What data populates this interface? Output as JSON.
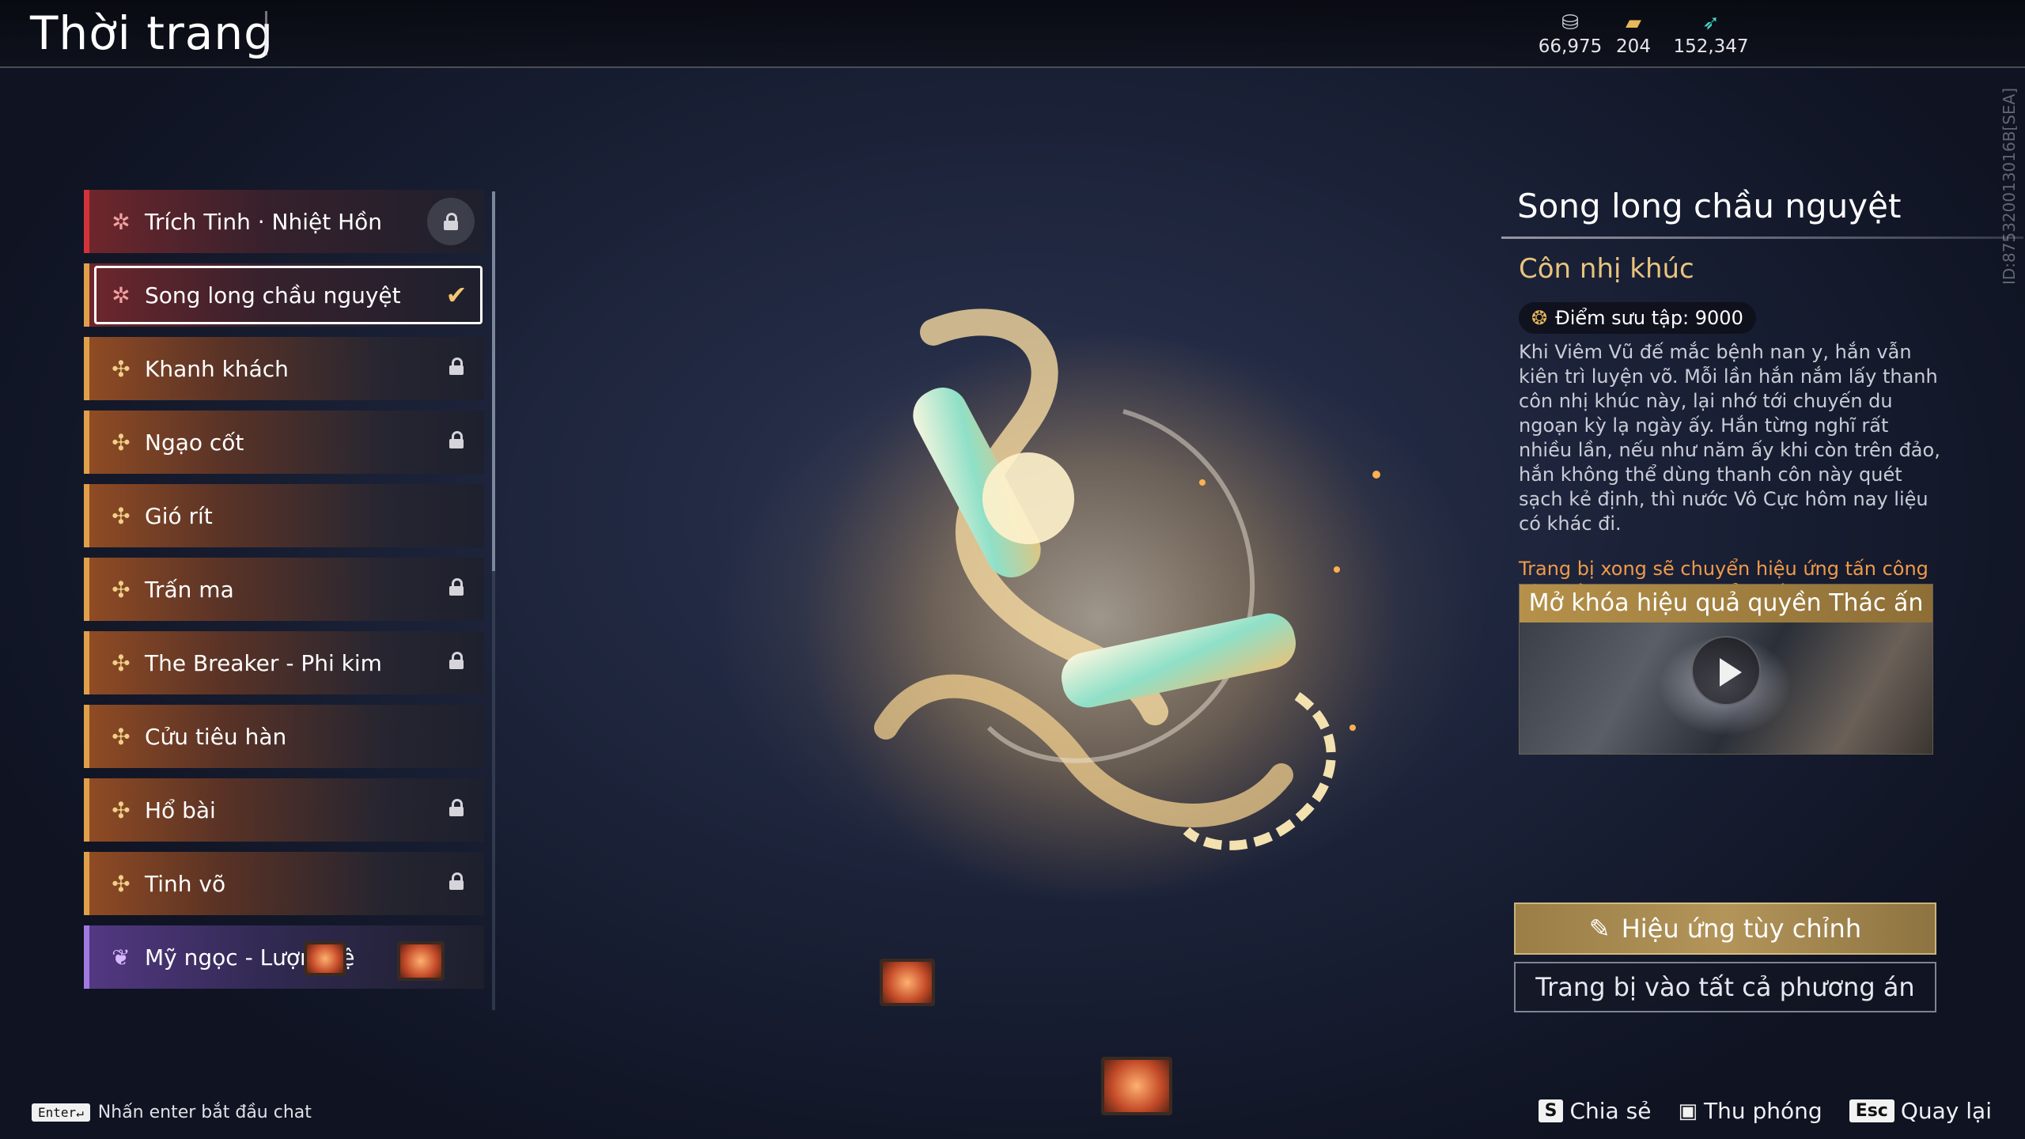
{
  "header": {
    "title": "Thời trang",
    "currencies": [
      {
        "icon": "coin-stack-icon",
        "value": "66,975"
      },
      {
        "icon": "treasure-chest-icon",
        "value": "204"
      },
      {
        "icon": "feather-icon",
        "value": "152,347"
      }
    ],
    "side_id": "ID:875320013016B[SEA]"
  },
  "list": {
    "items": [
      {
        "label": "Trích Tinh · Nhiệt Hồn",
        "status": "locked",
        "style": "red"
      },
      {
        "label": "Song long chầu nguyệt",
        "status": "equipped",
        "style": "selected"
      },
      {
        "label": "Khanh khách",
        "status": "locked",
        "style": "gold"
      },
      {
        "label": "Ngạo cốt",
        "status": "locked",
        "style": "gold"
      },
      {
        "label": "Gió rít",
        "status": "none",
        "style": "gold"
      },
      {
        "label": "Trấn ma",
        "status": "locked",
        "style": "gold"
      },
      {
        "label": "The Breaker - Phi kim",
        "status": "locked",
        "style": "gold"
      },
      {
        "label": "Cửu tiêu hàn",
        "status": "none",
        "style": "gold"
      },
      {
        "label": "Hổ bài",
        "status": "locked",
        "style": "gold"
      },
      {
        "label": "Tinh võ",
        "status": "locked",
        "style": "gold"
      },
      {
        "label": "Mỹ ngọc - Lượng lệ",
        "status": "none",
        "style": "purple"
      }
    ],
    "check_glyph": "✔"
  },
  "detail": {
    "name": "Song long chầu nguyệt",
    "type": "Côn nhị khúc",
    "collection_points": "Điểm sưu tập: 9000",
    "description": "Khi Viêm Vũ đế mắc bệnh nan y, hắn vẫn kiên trì luyện võ. Mỗi lần hắn nắm lấy thanh côn nhị khúc này, lại nhớ tới chuyến du ngoạn kỳ lạ ngày ấy. Hắn từng nghĩ rất nhiều lần, nếu như năm ấy khi còn trên đảo, hắn không thể dùng thanh côn này quét sạch kẻ định, thì nước Vô Cực hôm nay liệu có khác đi.",
    "effect_note": "Trang bị xong sẽ chuyển hiệu ứng tấn công của Hồn ngọc [Long hổ khiếu].",
    "video_title": "Mở khóa hiệu quả quyền Thác ấn",
    "custom_effect_label": "Hiệu ứng tùy chỉnh",
    "equip_all_label": "Trang bị vào tất cả phương án"
  },
  "footer": {
    "chat_key": "Enter↵",
    "chat_hint": "Nhấn enter bắt đầu chat",
    "share_key": "S",
    "share_label": "Chia sẻ",
    "zoom_label": "Thu phóng",
    "back_key": "Esc",
    "back_label": "Quay lại"
  },
  "colors": {
    "accent_gold": "#e9c47e",
    "effect_orange": "#f09a4a",
    "rarity_red": "#d0333a",
    "rarity_gold": "#e0a04a",
    "rarity_purple": "#a07ae0"
  }
}
